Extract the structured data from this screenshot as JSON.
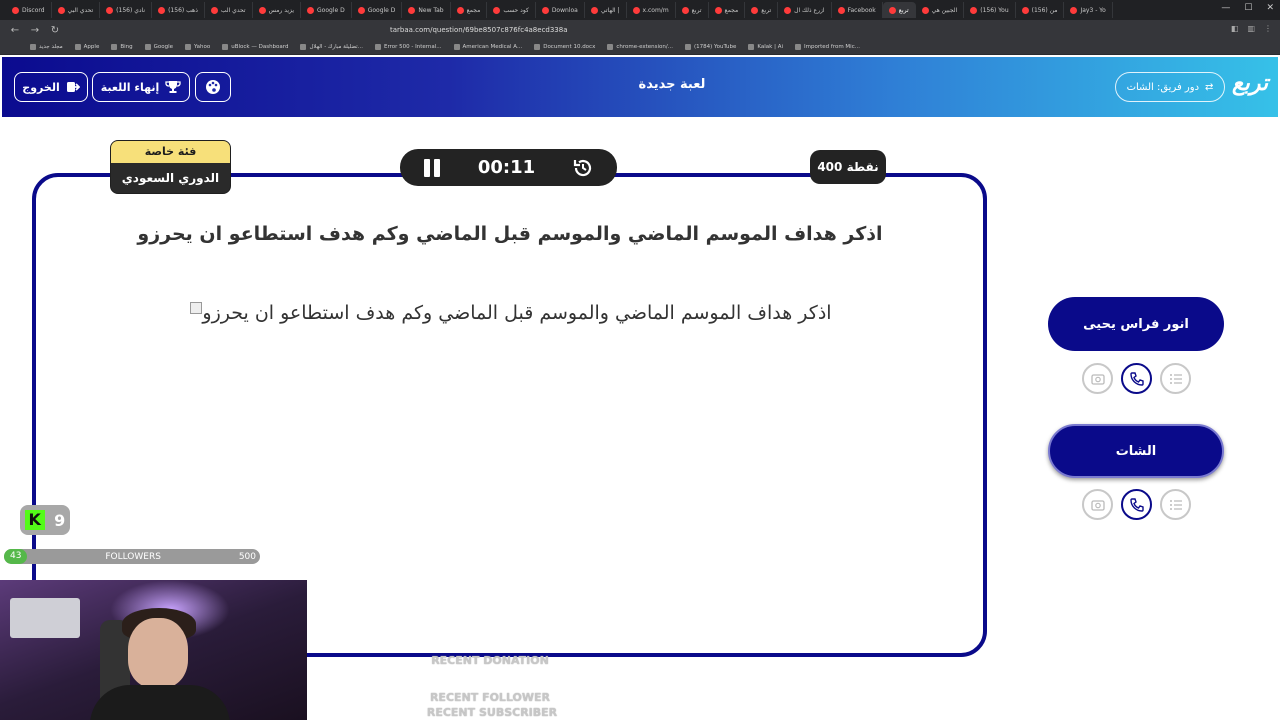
{
  "browser": {
    "tabs": [
      "Discord",
      "تحدي البي",
      "(156) نادي",
      "(156) ذهب",
      "تحدي الب",
      "يزيد رمس",
      "Google D",
      "Google D",
      "New Tab",
      "مجمع",
      "كود حسب",
      "Downloa",
      "الهاتي |",
      "x.com/m",
      "تربع",
      "مجمع",
      "تربع",
      "ازرع ذلك ال",
      "Facebook",
      "تربع",
      "الجبين هي",
      "(156) You",
      "(156) من",
      "Jay3 - Yo"
    ],
    "url": "tarbaa.com/question/69be8507c876fc4a8ecd338a",
    "bookmarks": [
      "مجلد جديد",
      "Apple",
      "Bing",
      "Google",
      "Yahoo",
      "uBlock — Dashboard",
      "تضليلة مبارك - الهلال...",
      "Error 500 - Internal...",
      "American Medical A...",
      "Document 10.docx",
      "chrome-extension/...",
      "(1784) YouTube",
      "Kalak | Ai",
      "Imported from Mic..."
    ]
  },
  "header": {
    "exit_label": "الخروج",
    "end_game_label": "إنهاء اللعبة",
    "title": "لعبة جديدة",
    "turn_label": "دور فريق: الشات",
    "logo": "تربع"
  },
  "question": {
    "category_top": "فئة خاصة",
    "category_bottom": "الدوري السعودي",
    "timer": "00:11",
    "points": "400 نقطة",
    "text": "اذكر هداف الموسم الماضي والموسم قبل الماضي وكم هدف استطاعو ان يحرزو",
    "image_alt": "اذكر هداف الموسم الماضي والموسم قبل الماضي وكم هدف استطاعو ان يحرزو"
  },
  "teams": [
    {
      "name": "انور فراس يحيى"
    },
    {
      "name": "الشات"
    }
  ],
  "stream": {
    "kick_count": "9",
    "followers_current": "43",
    "followers_label": "FOLLOWERS",
    "followers_goal": "500",
    "recent_donation": "RECENT DONATION",
    "recent_follower": "RECENT FOLLOWER",
    "recent_subscriber": "RECENT SUBSCRIBER"
  },
  "colors": {
    "primary": "#0a0a8a",
    "category_yellow": "#f7e07a",
    "dark": "#232323",
    "kick_green": "#53fc18"
  }
}
